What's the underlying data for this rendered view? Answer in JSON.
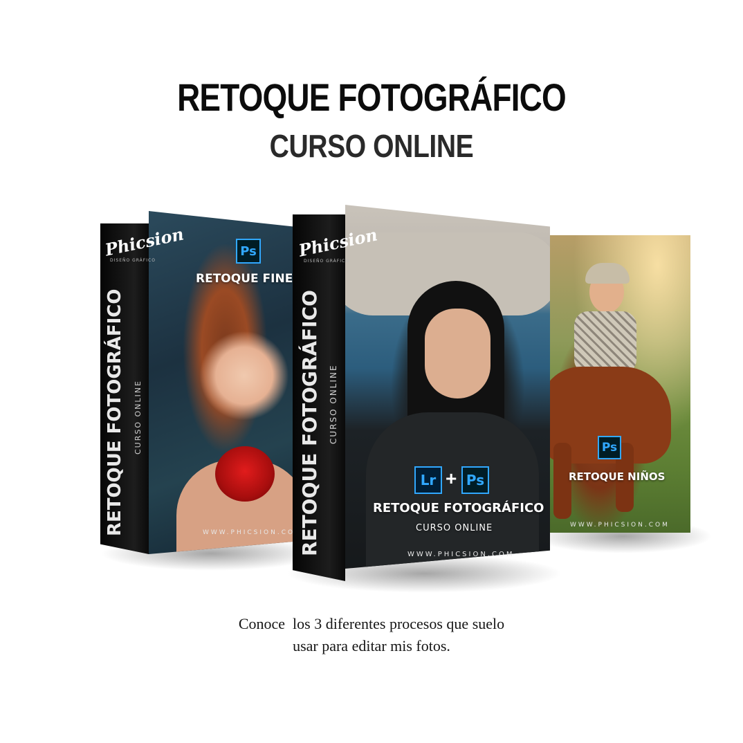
{
  "header": {
    "title": "RETOQUE FOTOGRÁFICO",
    "subtitle": "CURSO ONLINE"
  },
  "products": [
    {
      "logo": "Phicsion",
      "logo_tagline": "DISEÑO GRÁFICO",
      "spine_title": "RETOQUE FOTOGRÁFICO",
      "spine_subtitle": "CURSO ONLINE",
      "badge": "Ps",
      "face_title": "RETOQUE FINE A",
      "url": "WWW.PHICSION.COM"
    },
    {
      "logo": "Phicsion",
      "logo_tagline": "DISEÑO GRÁFICO",
      "spine_title": "RETOQUE FOTOGRÁFICO",
      "spine_subtitle": "CURSO ONLINE",
      "badge_left": "Lr",
      "badge_plus": "+",
      "badge_right": "Ps",
      "face_title": "RETOQUE FOTOGRÁFICO",
      "face_subtitle": "CURSO ONLINE",
      "url": "WWW.PHICSION.COM"
    },
    {
      "badge": "Ps",
      "face_title": "RETOQUE NIÑOS",
      "url": "WWW.PHICSION.COM"
    }
  ],
  "caption": {
    "line1": "Conoce  los 3 diferentes procesos que suelo",
    "line2": "usar para editar mis fotos."
  },
  "colors": {
    "background": "#ffffff",
    "title": "#0c0c0c",
    "spine": "#111111",
    "ps_badge_border": "#31a8ff",
    "ps_badge_bg": "#001d26"
  }
}
